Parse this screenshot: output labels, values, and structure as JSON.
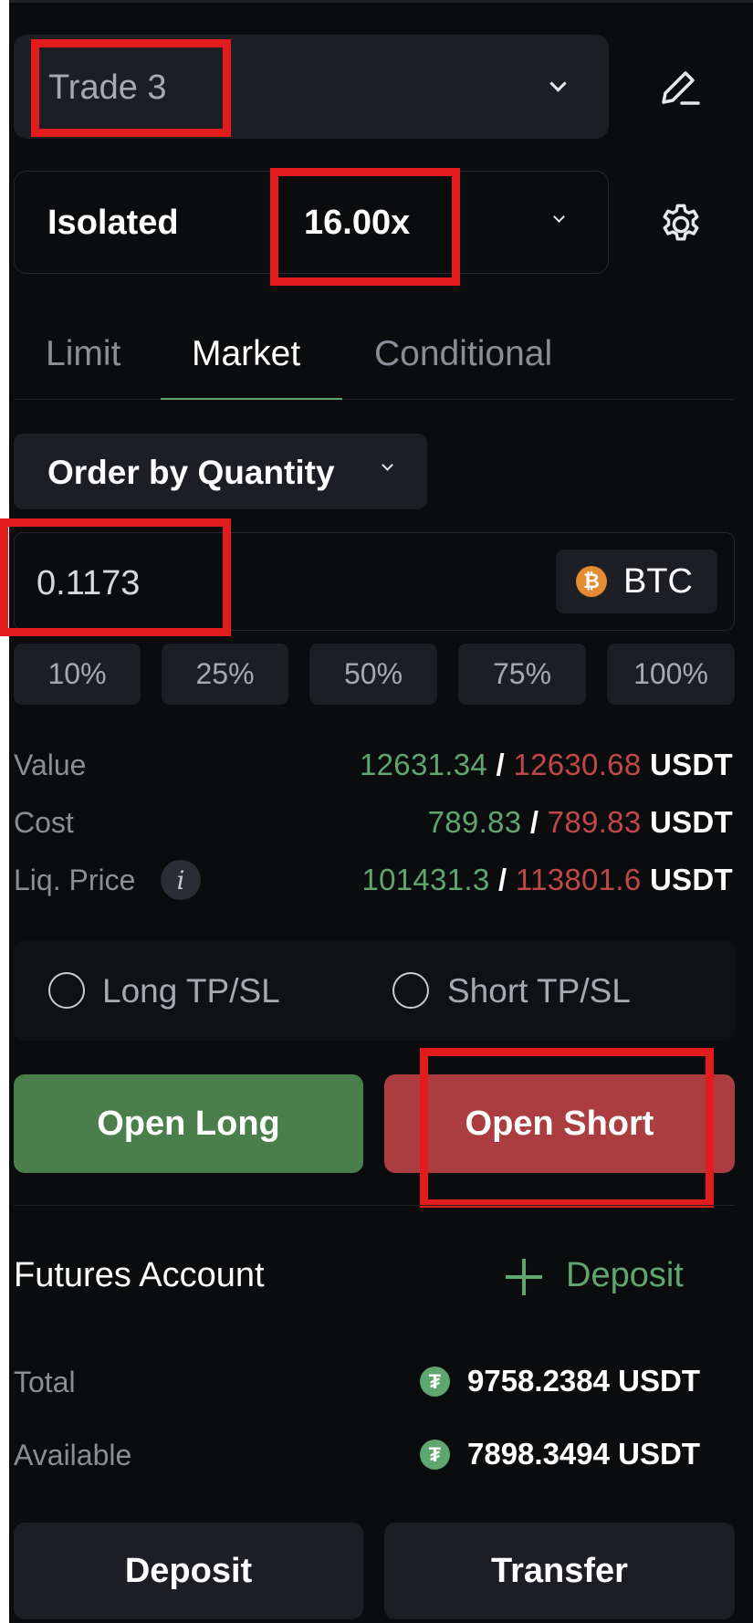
{
  "trade_selector": {
    "value": "Trade 3"
  },
  "margin": {
    "mode": "Isolated",
    "leverage": "16.00x"
  },
  "tabs": [
    {
      "label": "Limit",
      "active": false
    },
    {
      "label": "Market",
      "active": true
    },
    {
      "label": "Conditional",
      "active": false
    }
  ],
  "order_type": {
    "label": "Order by Quantity"
  },
  "quantity": {
    "value": "0.1173",
    "asset": "BTC",
    "asset_icon": "bitcoin-icon"
  },
  "percent_options": [
    "10%",
    "25%",
    "50%",
    "75%",
    "100%"
  ],
  "order_info": {
    "value": {
      "label": "Value",
      "long": "12631.34",
      "short": "12630.68",
      "unit": "USDT"
    },
    "cost": {
      "label": "Cost",
      "long": "789.83",
      "short": "789.83",
      "unit": "USDT"
    },
    "liq_price": {
      "label": "Liq. Price",
      "long": "101431.3",
      "short": "113801.6",
      "unit": "USDT",
      "info_icon": "info-icon"
    }
  },
  "tpsl": {
    "long_label": "Long TP/SL",
    "short_label": "Short TP/SL"
  },
  "actions": {
    "open_long": "Open Long",
    "open_short": "Open Short"
  },
  "account": {
    "title": "Futures Account",
    "deposit_link": "Deposit",
    "total": {
      "label": "Total",
      "value": "9758.2384 USDT"
    },
    "available": {
      "label": "Available",
      "value": "7898.3494 USDT"
    },
    "currency_icon": "tether-icon"
  },
  "footer": {
    "deposit": "Deposit",
    "transfer": "Transfer"
  },
  "colors": {
    "background": "#0b0c0e",
    "panel": "#1c1e23",
    "long_green": "#5fa66f",
    "short_red": "#c0484a",
    "long_button": "#4a7f4c",
    "short_button": "#ab3d40",
    "annotation_red": "#e21c1c"
  }
}
